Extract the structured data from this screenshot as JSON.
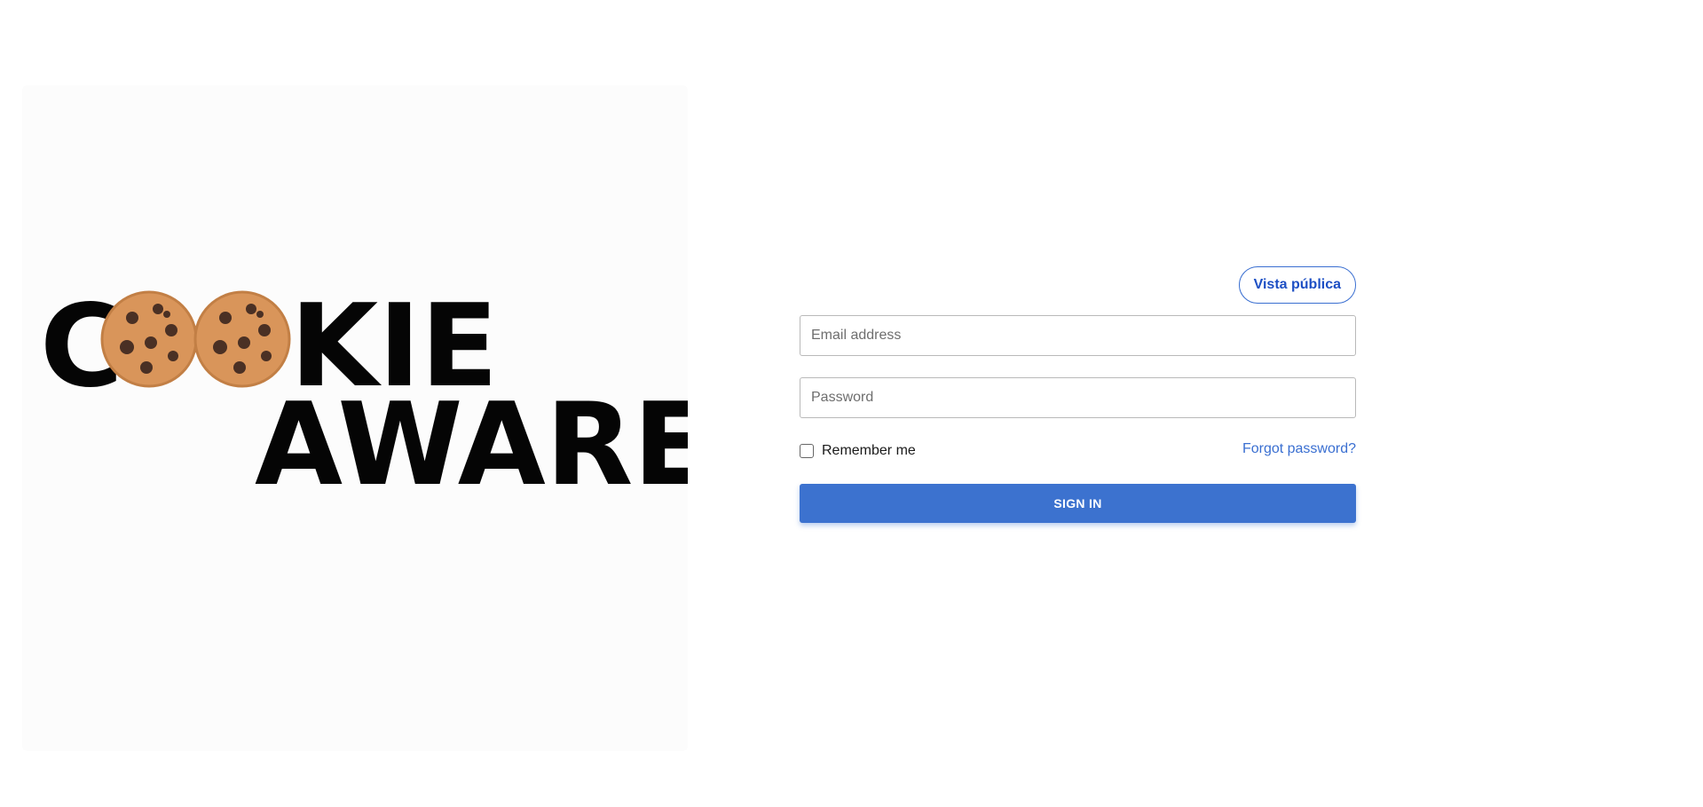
{
  "logo": {
    "line1": "C  KIE",
    "line2": "AWARE"
  },
  "login": {
    "public_view_label": "Vista pública",
    "email_placeholder": "Email address",
    "password_placeholder": "Password",
    "remember_label": "Remember me",
    "remember_checked": false,
    "forgot_label": "Forgot password?",
    "signin_label": "SIGN IN"
  },
  "colors": {
    "accent": "#3c72cf",
    "link": "#3a6fd1",
    "cookie": "#d9955a",
    "chip": "#4a3024"
  }
}
